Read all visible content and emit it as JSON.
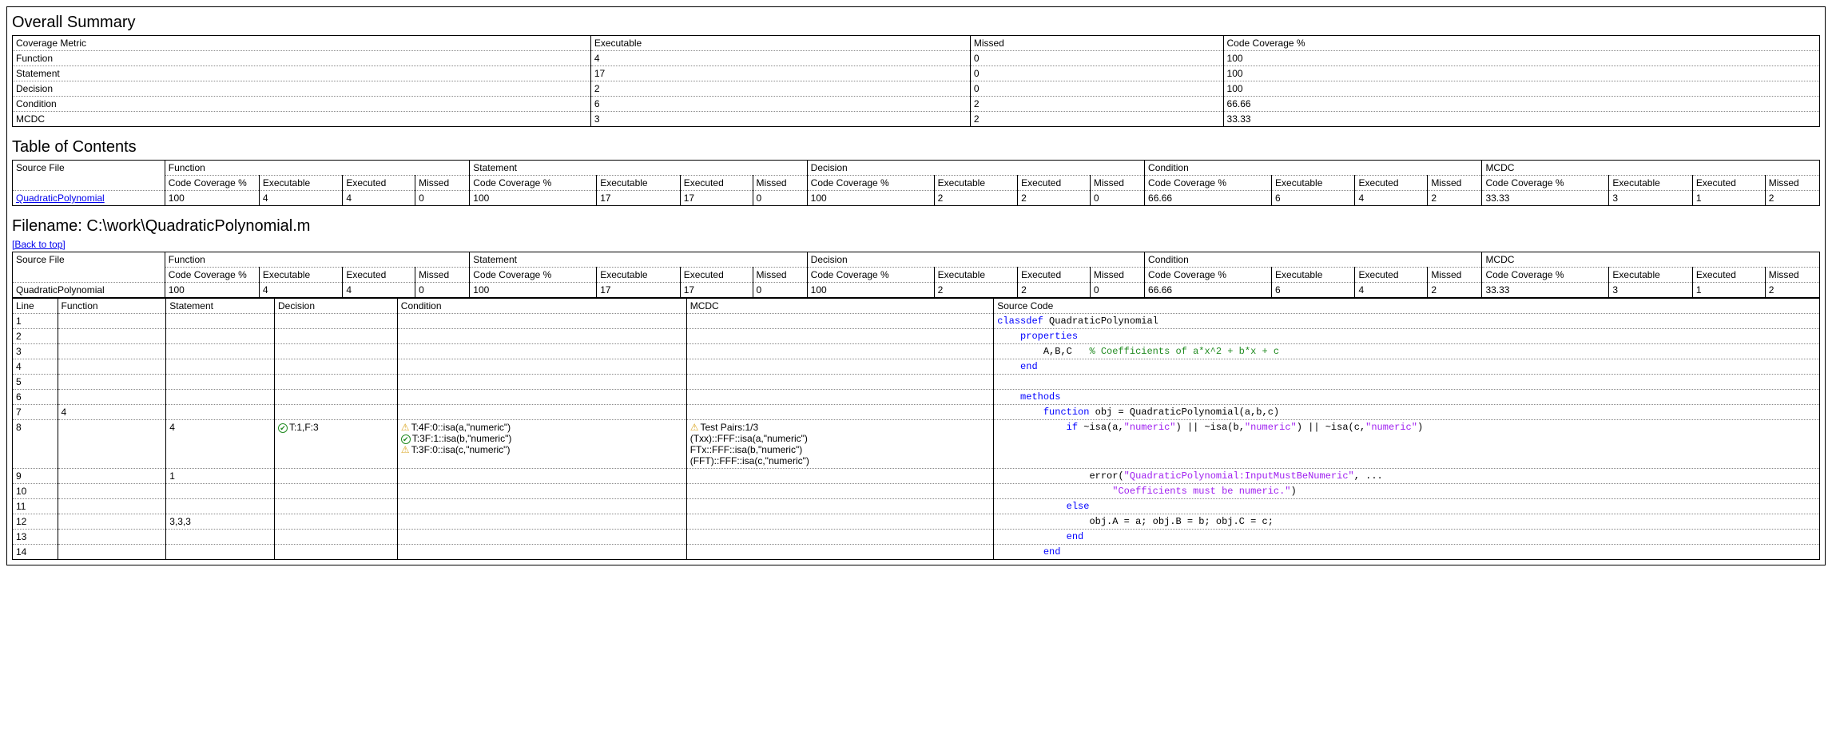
{
  "overall_summary": {
    "heading": "Overall Summary",
    "headers": [
      "Coverage Metric",
      "Executable",
      "Missed",
      "Code Coverage %"
    ],
    "rows": [
      {
        "metric": "Function",
        "executable": "4",
        "missed": "0",
        "pct": "100"
      },
      {
        "metric": "Statement",
        "executable": "17",
        "missed": "0",
        "pct": "100"
      },
      {
        "metric": "Decision",
        "executable": "2",
        "missed": "0",
        "pct": "100"
      },
      {
        "metric": "Condition",
        "executable": "6",
        "missed": "2",
        "pct": "66.66"
      },
      {
        "metric": "MCDC",
        "executable": "3",
        "missed": "2",
        "pct": "33.33"
      }
    ]
  },
  "toc": {
    "heading": "Table of Contents",
    "source_file_hdr": "Source File",
    "groups": [
      "Function",
      "Statement",
      "Decision",
      "Condition",
      "MCDC"
    ],
    "subheaders": [
      "Code Coverage %",
      "Executable",
      "Executed",
      "Missed"
    ],
    "row": {
      "source_file": "QuadraticPolynomial",
      "vals": [
        "100",
        "4",
        "4",
        "0",
        "100",
        "17",
        "17",
        "0",
        "100",
        "2",
        "2",
        "0",
        "66.66",
        "6",
        "4",
        "2",
        "33.33",
        "3",
        "1",
        "2"
      ]
    }
  },
  "file_detail": {
    "heading": "Filename: C:\\work\\QuadraticPolynomial.m",
    "back_link": "[Back to top]",
    "source_file_hdr": "Source File",
    "groups": [
      "Function",
      "Statement",
      "Decision",
      "Condition",
      "MCDC"
    ],
    "subheaders": [
      "Code Coverage %",
      "Executable",
      "Executed",
      "Missed"
    ],
    "row": {
      "source_file": "QuadraticPolynomial",
      "vals": [
        "100",
        "4",
        "4",
        "0",
        "100",
        "17",
        "17",
        "0",
        "100",
        "2",
        "2",
        "0",
        "66.66",
        "6",
        "4",
        "2",
        "33.33",
        "3",
        "1",
        "2"
      ]
    }
  },
  "code_table": {
    "headers": [
      "Line",
      "Function",
      "Statement",
      "Decision",
      "Condition",
      "MCDC",
      "Source Code"
    ],
    "rows": [
      {
        "line": "1",
        "func": "",
        "stmt": "",
        "dec": "",
        "cond": [],
        "mcdc": [],
        "code_html": "<span class='kw'>classdef</span> QuadraticPolynomial"
      },
      {
        "line": "2",
        "func": "",
        "stmt": "",
        "dec": "",
        "cond": [],
        "mcdc": [],
        "code_html": "    <span class='kw'>properties</span>"
      },
      {
        "line": "3",
        "func": "",
        "stmt": "",
        "dec": "",
        "cond": [],
        "mcdc": [],
        "code_html": "        A,B,C   <span class='com'>% Coefficients of a*x^2 + b*x + c</span>"
      },
      {
        "line": "4",
        "func": "",
        "stmt": "",
        "dec": "",
        "cond": [],
        "mcdc": [],
        "code_html": "    <span class='kw'>end</span>"
      },
      {
        "line": "5",
        "func": "",
        "stmt": "",
        "dec": "",
        "cond": [],
        "mcdc": [],
        "code_html": ""
      },
      {
        "line": "6",
        "func": "",
        "stmt": "",
        "dec": "",
        "cond": [],
        "mcdc": [],
        "code_html": "    <span class='kw'>methods</span>"
      },
      {
        "line": "7",
        "func": "4",
        "stmt": "",
        "dec": "",
        "cond": [],
        "mcdc": [],
        "code_html": "        <span class='kw'>function</span> obj = QuadraticPolynomial(a,b,c)"
      },
      {
        "line": "8",
        "func": "",
        "stmt": "4",
        "dec": "T:1,F:3",
        "dec_icon": "ok",
        "cond": [
          {
            "icon": "warn",
            "text": "T:4F:0::isa(a,\"numeric\")"
          },
          {
            "icon": "ok",
            "text": "T:3F:1::isa(b,\"numeric\")"
          },
          {
            "icon": "warn",
            "text": "T:3F:0::isa(c,\"numeric\")"
          }
        ],
        "mcdc": [
          {
            "icon": "warn",
            "text": "Test Pairs:1/3"
          },
          {
            "icon": "",
            "text": "(Txx)::FFF::isa(a,\"numeric\")"
          },
          {
            "icon": "",
            "text": "FTx::FFF::isa(b,\"numeric\")"
          },
          {
            "icon": "",
            "text": "(FFT)::FFF::isa(c,\"numeric\")"
          }
        ],
        "code_html": "            <span class='kw'>if</span> ~isa(a,<span class='str'>\"numeric\"</span>) || ~isa(b,<span class='str'>\"numeric\"</span>) || ~isa(c,<span class='str'>\"numeric\"</span>)"
      },
      {
        "line": "9",
        "func": "",
        "stmt": "1",
        "dec": "",
        "cond": [],
        "mcdc": [],
        "code_html": "                error(<span class='str'>\"QuadraticPolynomial:InputMustBeNumeric\"</span>, ..."
      },
      {
        "line": "10",
        "func": "",
        "stmt": "",
        "dec": "",
        "cond": [],
        "mcdc": [],
        "code_html": "                    <span class='str'>\"Coefficients must be numeric.\"</span>)"
      },
      {
        "line": "11",
        "func": "",
        "stmt": "",
        "dec": "",
        "cond": [],
        "mcdc": [],
        "code_html": "            <span class='kw'>else</span>"
      },
      {
        "line": "12",
        "func": "",
        "stmt": "3,3,3",
        "dec": "",
        "cond": [],
        "mcdc": [],
        "code_html": "                obj.A = a; obj.B = b; obj.C = c;"
      },
      {
        "line": "13",
        "func": "",
        "stmt": "",
        "dec": "",
        "cond": [],
        "mcdc": [],
        "code_html": "            <span class='kw'>end</span>"
      },
      {
        "line": "14",
        "func": "",
        "stmt": "",
        "dec": "",
        "cond": [],
        "mcdc": [],
        "code_html": "        <span class='kw'>end</span>"
      }
    ]
  }
}
